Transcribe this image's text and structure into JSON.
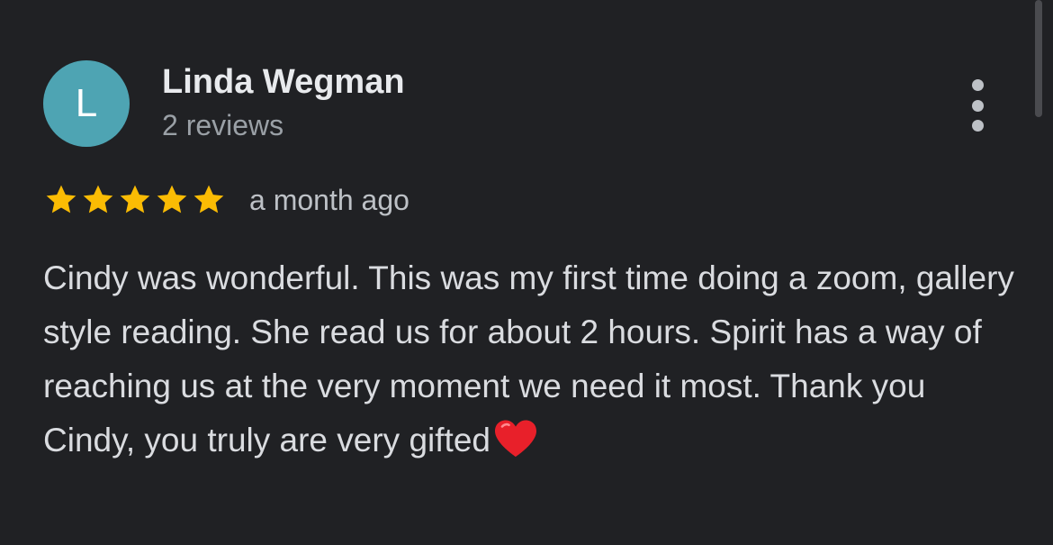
{
  "reviewer": {
    "initial": "L",
    "name": "Linda Wegman",
    "review_count": "2 reviews",
    "avatar_color": "#4ea4b3"
  },
  "rating": {
    "stars": 5,
    "max_stars": 5,
    "star_color": "#fbbc04",
    "date": "a month ago"
  },
  "review": {
    "text": "Cindy was wonderful. This was my first time doing a zoom, gallery style reading. She read us for about 2 hours. Spirit has a way of reaching us at the very moment we need it most. Thank you Cindy, you truly are very gifted",
    "trailing_emoji": "heart-icon"
  },
  "menu": {
    "icon": "more-vert-icon"
  }
}
